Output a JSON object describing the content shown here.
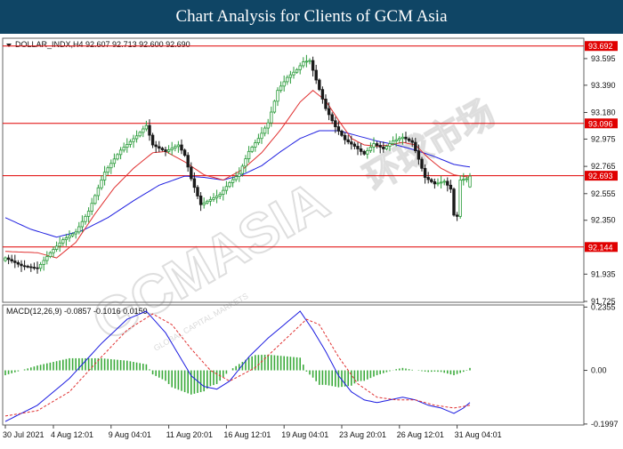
{
  "banner": {
    "title": "Chart Analysis for Clients of GCM Asia"
  },
  "watermark": {
    "text": "GCMASIA",
    "cn": "环球市场",
    "sub": "GLOBAL CAPITAL MARKETS"
  },
  "chart_data": {
    "type": "candlestick",
    "header": "DOLLAR_INDX,H4 92.607 92.713 92.600 92.690",
    "symbol": "DOLLAR_INDX",
    "timeframe": "H4",
    "last_ohlc": {
      "open": 92.607,
      "high": 92.713,
      "low": 92.6,
      "close": 92.69
    },
    "ylim": [
      91.725,
      93.745
    ],
    "yticks": [
      93.595,
      93.39,
      93.18,
      92.975,
      92.765,
      92.555,
      92.35,
      91.935,
      91.725
    ],
    "xticks": [
      {
        "i": 0,
        "label": "30 Jul 2021"
      },
      {
        "i": 15,
        "label": "4 Aug 12:01"
      },
      {
        "i": 33,
        "label": "9 Aug 04:01"
      },
      {
        "i": 51,
        "label": "11 Aug 20:01"
      },
      {
        "i": 69,
        "label": "16 Aug 12:01"
      },
      {
        "i": 87,
        "label": "19 Aug 04:01"
      },
      {
        "i": 105,
        "label": "23 Aug 20:01"
      },
      {
        "i": 123,
        "label": "26 Aug 12:01"
      },
      {
        "i": 141,
        "label": "31 Aug 04:01"
      }
    ],
    "levels": [
      {
        "value": 93.692,
        "label": "93.692"
      },
      {
        "value": 93.096,
        "label": "93.096"
      },
      {
        "value": 92.693,
        "label": "92.693"
      },
      {
        "value": 92.144,
        "label": "92.144"
      }
    ],
    "candle_close_anchors": [
      [
        0,
        92.06
      ],
      [
        5,
        92.0
      ],
      [
        10,
        91.98
      ],
      [
        14,
        92.1
      ],
      [
        18,
        92.2
      ],
      [
        22,
        92.26
      ],
      [
        26,
        92.42
      ],
      [
        31,
        92.72
      ],
      [
        36,
        92.89
      ],
      [
        41,
        93.0
      ],
      [
        44,
        93.08
      ],
      [
        46,
        92.93
      ],
      [
        50,
        92.88
      ],
      [
        54,
        92.93
      ],
      [
        56,
        92.85
      ],
      [
        58,
        92.67
      ],
      [
        61,
        92.47
      ],
      [
        64,
        92.51
      ],
      [
        67,
        92.55
      ],
      [
        70,
        92.64
      ],
      [
        73,
        92.71
      ],
      [
        76,
        92.88
      ],
      [
        79,
        92.98
      ],
      [
        82,
        93.1
      ],
      [
        85,
        93.35
      ],
      [
        88,
        93.45
      ],
      [
        91,
        93.51
      ],
      [
        93,
        93.57
      ],
      [
        95,
        93.58
      ],
      [
        97,
        93.43
      ],
      [
        100,
        93.21
      ],
      [
        103,
        93.07
      ],
      [
        106,
        92.97
      ],
      [
        109,
        92.92
      ],
      [
        112,
        92.86
      ],
      [
        115,
        92.94
      ],
      [
        118,
        92.9
      ],
      [
        121,
        92.96
      ],
      [
        124,
        92.99
      ],
      [
        127,
        92.95
      ],
      [
        129,
        92.82
      ],
      [
        131,
        92.68
      ],
      [
        134,
        92.63
      ],
      [
        137,
        92.65
      ],
      [
        139,
        92.59
      ],
      [
        140,
        92.39
      ],
      [
        141,
        92.38
      ],
      [
        142,
        92.66
      ],
      [
        144,
        92.67
      ],
      [
        145,
        92.69
      ]
    ],
    "ma_red_anchors": [
      [
        0,
        92.11
      ],
      [
        10,
        92.1
      ],
      [
        16,
        92.06
      ],
      [
        22,
        92.18
      ],
      [
        28,
        92.4
      ],
      [
        34,
        92.6
      ],
      [
        40,
        92.75
      ],
      [
        46,
        92.87
      ],
      [
        50,
        92.88
      ],
      [
        56,
        92.8
      ],
      [
        62,
        92.7
      ],
      [
        68,
        92.66
      ],
      [
        74,
        92.74
      ],
      [
        80,
        92.87
      ],
      [
        86,
        93.05
      ],
      [
        92,
        93.26
      ],
      [
        96,
        93.35
      ],
      [
        100,
        93.27
      ],
      [
        104,
        93.12
      ],
      [
        108,
        92.98
      ],
      [
        112,
        92.93
      ],
      [
        116,
        92.92
      ],
      [
        120,
        92.93
      ],
      [
        124,
        92.95
      ],
      [
        128,
        92.93
      ],
      [
        132,
        92.83
      ],
      [
        136,
        92.75
      ],
      [
        140,
        92.7
      ],
      [
        145,
        92.68
      ]
    ],
    "ma_blue_anchors": [
      [
        0,
        92.37
      ],
      [
        8,
        92.28
      ],
      [
        16,
        92.22
      ],
      [
        24,
        92.27
      ],
      [
        32,
        92.37
      ],
      [
        40,
        92.5
      ],
      [
        48,
        92.62
      ],
      [
        56,
        92.69
      ],
      [
        62,
        92.68
      ],
      [
        68,
        92.66
      ],
      [
        74,
        92.7
      ],
      [
        80,
        92.77
      ],
      [
        86,
        92.88
      ],
      [
        92,
        92.98
      ],
      [
        98,
        93.04
      ],
      [
        104,
        93.04
      ],
      [
        110,
        93.0
      ],
      [
        116,
        92.96
      ],
      [
        122,
        92.93
      ],
      [
        128,
        92.89
      ],
      [
        134,
        92.84
      ],
      [
        140,
        92.78
      ],
      [
        145,
        92.76
      ]
    ],
    "macd": {
      "label": "MACD(12,26,9) -0.0857 -0.1016 0.0159",
      "params": [
        12,
        26,
        9
      ],
      "main": -0.0857,
      "signal": -0.1016,
      "histogram": 0.0159,
      "ylim": [
        -0.2,
        0.24
      ],
      "yticks": [
        0.2355,
        0.0,
        -0.1997
      ],
      "macd_anchors": [
        [
          0,
          -0.19
        ],
        [
          10,
          -0.13
        ],
        [
          20,
          -0.03
        ],
        [
          30,
          0.1
        ],
        [
          38,
          0.19
        ],
        [
          44,
          0.22
        ],
        [
          50,
          0.14
        ],
        [
          54,
          0.06
        ],
        [
          58,
          -0.02
        ],
        [
          62,
          -0.06
        ],
        [
          66,
          -0.07
        ],
        [
          70,
          -0.04
        ],
        [
          76,
          0.05
        ],
        [
          82,
          0.12
        ],
        [
          88,
          0.18
        ],
        [
          92,
          0.22
        ],
        [
          96,
          0.15
        ],
        [
          100,
          0.07
        ],
        [
          104,
          -0.02
        ],
        [
          108,
          -0.08
        ],
        [
          112,
          -0.11
        ],
        [
          116,
          -0.12
        ],
        [
          120,
          -0.11
        ],
        [
          124,
          -0.1
        ],
        [
          128,
          -0.11
        ],
        [
          132,
          -0.13
        ],
        [
          136,
          -0.14
        ],
        [
          140,
          -0.16
        ],
        [
          143,
          -0.14
        ],
        [
          145,
          -0.12
        ]
      ],
      "signal_anchors": [
        [
          0,
          -0.17
        ],
        [
          10,
          -0.15
        ],
        [
          20,
          -0.08
        ],
        [
          30,
          0.05
        ],
        [
          38,
          0.15
        ],
        [
          46,
          0.21
        ],
        [
          52,
          0.17
        ],
        [
          58,
          0.08
        ],
        [
          64,
          0.0
        ],
        [
          70,
          -0.04
        ],
        [
          78,
          0.01
        ],
        [
          86,
          0.1
        ],
        [
          94,
          0.19
        ],
        [
          98,
          0.17
        ],
        [
          104,
          0.05
        ],
        [
          110,
          -0.05
        ],
        [
          116,
          -0.1
        ],
        [
          122,
          -0.11
        ],
        [
          128,
          -0.11
        ],
        [
          134,
          -0.13
        ],
        [
          140,
          -0.14
        ],
        [
          145,
          -0.13
        ]
      ]
    }
  },
  "colors": {
    "banner": "#0f4565",
    "bull": "#2a9b3a",
    "bear": "#1a1a1a",
    "ma_red": "#e03030",
    "ma_blue": "#2020e0",
    "level": "#e00000",
    "macd_main": "#1a1ae0",
    "macd_signal": "#e03030",
    "macd_hist": "#3aaa3a",
    "axis": "#444444"
  }
}
